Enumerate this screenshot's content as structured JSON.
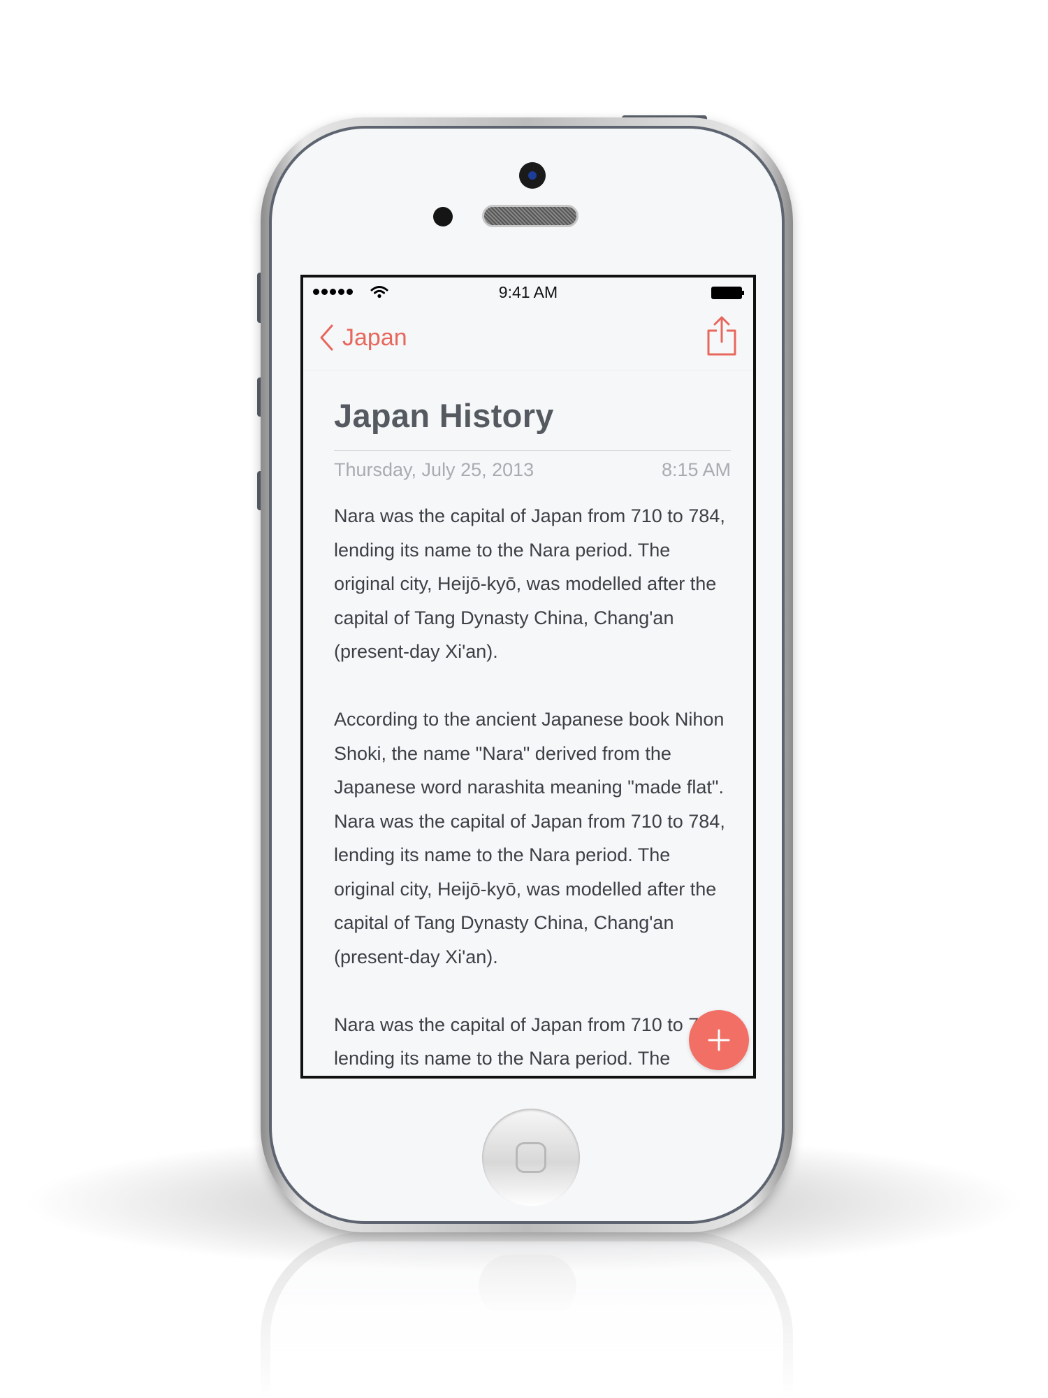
{
  "status_bar": {
    "time": "9:41 AM"
  },
  "nav": {
    "back_label": "Japan"
  },
  "note": {
    "title": "Japan History",
    "date": "Thursday, July 25, 2013",
    "time": "8:15 AM",
    "paragraphs": [
      "Nara was the capital of Japan from 710 to 784, lending its name to the Nara period. The original city, Heijō-kyō, was modelled after the capital of Tang Dynasty China, Chang'an (present-day Xi'an).",
      "According to the ancient Japanese book Nihon Shoki, the name \"Nara\" derived from the Japanese word narashita meaning \"made flat\". Nara was the capital of Japan from 710 to 784, lending its name to the Nara period. The original city, Heijō-kyō, was modelled after the capital of Tang Dynasty China, Chang'an (present-day Xi'an).",
      "Nara was the capital of Japan from 710 to 784, lending its name to the Nara period. The"
    ]
  },
  "colors": {
    "accent": "#e8675c",
    "fab": "#f26f65",
    "title": "#555a60",
    "meta": "#a8abb0",
    "body": "#3c3f44"
  },
  "icons": {
    "back": "chevron-left-icon",
    "share": "share-icon",
    "add": "plus-icon",
    "wifi": "wifi-icon",
    "battery": "battery-icon",
    "signal": "signal-dots-icon"
  }
}
